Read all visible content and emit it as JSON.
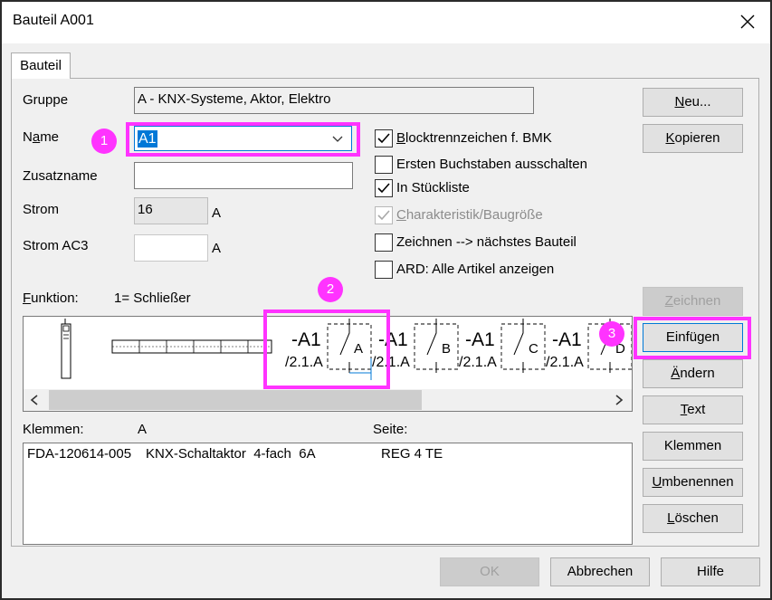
{
  "window": {
    "title": "Bauteil A001"
  },
  "tab": {
    "label": "Bauteil"
  },
  "form": {
    "gruppe_label": "Gruppe",
    "gruppe_value": "A - KNX-Systeme, Aktor, Elektro",
    "name_label_pre": "N",
    "name_label_u": "a",
    "name_label_post": "me",
    "name_value": "A1",
    "zusatz_label": "Zusatzname",
    "zusatz_value": "",
    "strom_label": "Strom",
    "strom_value": "16",
    "strom_unit": "A",
    "stromac3_label": "Strom AC3",
    "stromac3_value": "",
    "stromac3_unit": "A"
  },
  "checkboxes": [
    {
      "u": "B",
      "rest": "locktrennzeichen f. BMK",
      "checked": true,
      "disabled": false
    },
    {
      "u": "",
      "rest": "Ersten Buchstaben ausschalten",
      "checked": false,
      "disabled": false
    },
    {
      "u": "",
      "rest": "In Stückliste",
      "checked": true,
      "disabled": false
    },
    {
      "u": "C",
      "rest": "harakteristik/Baugröße",
      "checked": true,
      "disabled": true
    },
    {
      "u": "",
      "rest": "Zeichnen --> nächstes Bauteil",
      "checked": false,
      "disabled": false
    },
    {
      "u": "",
      "rest": "ARD: Alle Artikel anzeigen",
      "checked": false,
      "disabled": false
    }
  ],
  "funktion": {
    "label_u": "F",
    "label_rest": "unktion:",
    "value": "1= Schließer"
  },
  "symbols": [
    {
      "tag": "-A1",
      "ref": "/2.1.A",
      "letter": "A"
    },
    {
      "tag": "-A1",
      "ref": "/2.1.A",
      "letter": "B"
    },
    {
      "tag": "-A1",
      "ref": "/2.1.A",
      "letter": "C"
    },
    {
      "tag": "-A1",
      "ref": "/2.1.A",
      "letter": "D"
    }
  ],
  "klemmen": {
    "label": "Klemmen:",
    "value": "A",
    "seite_label": "Seite:"
  },
  "list_rows": [
    {
      "article": "FDA-120614-005",
      "desc": "KNX-Schaltaktor  4-fach  6A",
      "type": "REG 4 TE"
    }
  ],
  "side_buttons": {
    "neu_u": "N",
    "neu_rest": "eu...",
    "kopieren_u": "K",
    "kopieren_rest": "opieren",
    "zeichnen_u": "Z",
    "zeichnen_rest": "eichnen",
    "einfuegen": "Einfügen",
    "aendern_u": "Ä",
    "aendern_rest": "ndern",
    "text_u": "T",
    "text_rest": "ext",
    "klemmen": "Klemmen",
    "umbenennen_u": "U",
    "umbenennen_rest": "mbenennen",
    "loeschen_u": "L",
    "loeschen_rest": "öschen"
  },
  "footer": {
    "ok": "OK",
    "cancel": "Abbrechen",
    "help": "Hilfe"
  },
  "badges": [
    "1",
    "2",
    "3"
  ],
  "colors": {
    "highlight": "#ff33ff",
    "focus": "#0078d7"
  },
  "icons": {
    "close": "close-icon",
    "dropdown": "chevron-down-icon",
    "scroll_left": "chevron-left-icon",
    "scroll_right": "chevron-right-icon"
  }
}
